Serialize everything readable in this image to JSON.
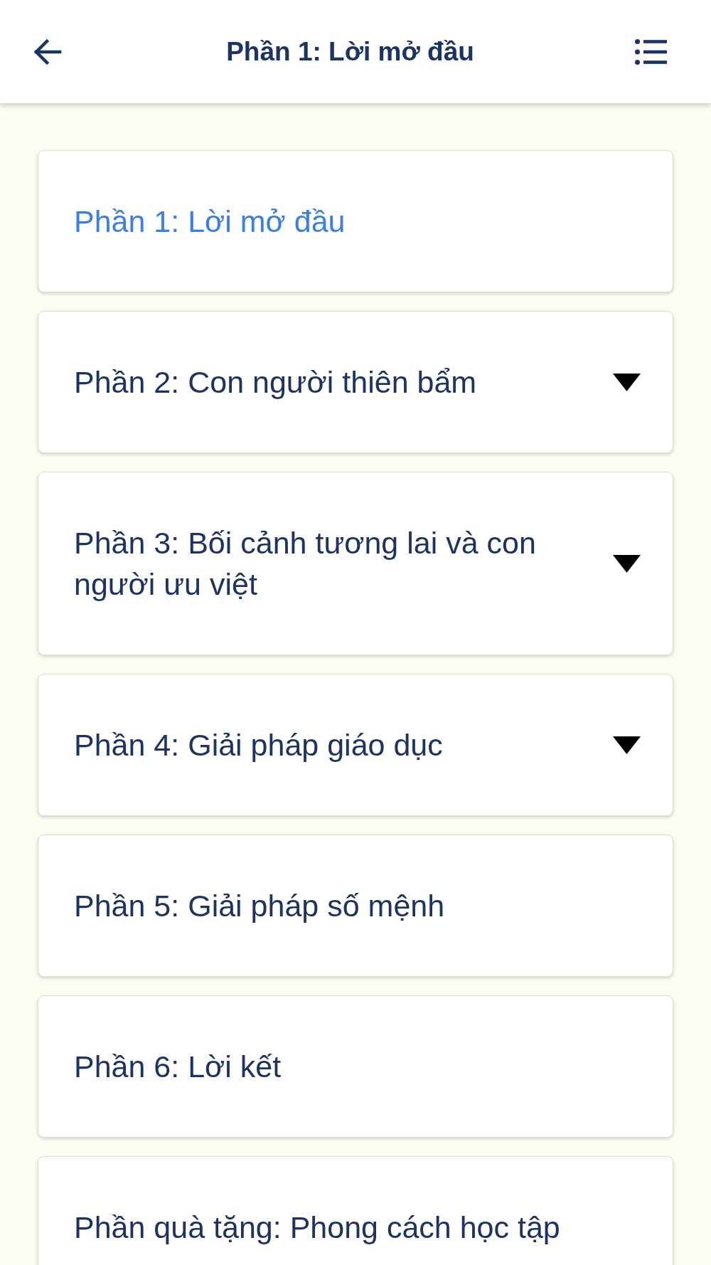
{
  "header": {
    "title": "Phần 1: Lời mở đầu"
  },
  "sections": [
    {
      "label": "Phần 1: Lời mở đầu",
      "selected": true,
      "expandable": false
    },
    {
      "label": "Phần 2: Con người thiên bẩm",
      "selected": false,
      "expandable": true
    },
    {
      "label": "Phần 3: Bối cảnh tương lai và con người ưu việt",
      "selected": false,
      "expandable": true
    },
    {
      "label": "Phần 4: Giải pháp giáo dục",
      "selected": false,
      "expandable": true
    },
    {
      "label": "Phần 5: Giải pháp số mệnh",
      "selected": false,
      "expandable": false
    },
    {
      "label": "Phần 6: Lời kết",
      "selected": false,
      "expandable": false
    },
    {
      "label": "Phần quà tặng: Phong cách học tập",
      "selected": false,
      "expandable": false
    }
  ]
}
